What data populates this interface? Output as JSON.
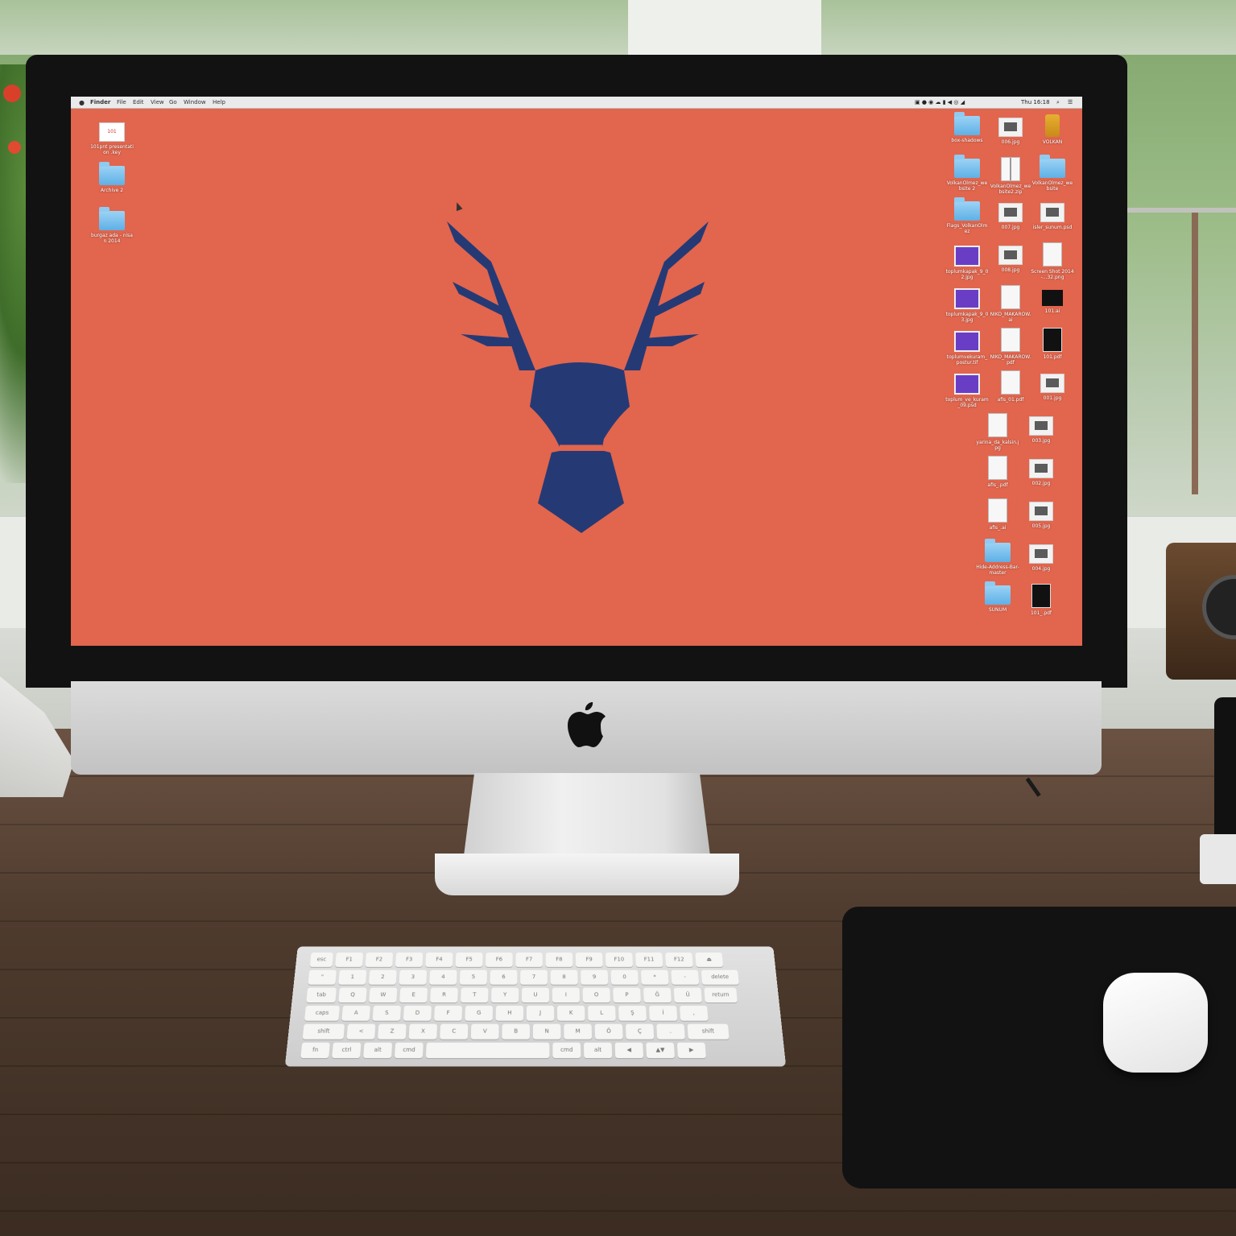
{
  "menubar": {
    "items": [
      "Finder",
      "File",
      "Edit",
      "View",
      "Go",
      "Window",
      "Help"
    ],
    "clock": "Thu 16:18"
  },
  "desktop": {
    "wallpaper_color": "#e2654d",
    "logo_color": "#253a75",
    "left_icons": [
      {
        "label": "101pnt presentation .key",
        "type": "keynote"
      },
      {
        "label": "Archive 2",
        "type": "folder"
      },
      {
        "label": "burgaz ada - nisan 2014",
        "type": "folder"
      }
    ],
    "right_icons": [
      {
        "label": "box-shadows",
        "type": "folder"
      },
      {
        "label": "006.jpg",
        "type": "thumb"
      },
      {
        "label": "VOLKAN",
        "type": "usb"
      },
      {
        "label": "VolkanOlmez_website 2",
        "type": "folder"
      },
      {
        "label": "VolkanOlmez_website2.zip",
        "type": "zip"
      },
      {
        "label": "VolkanOlmez_website",
        "type": "folder"
      },
      {
        "label": "Flags_VolkanOlmez",
        "type": "folder"
      },
      {
        "label": "007.jpg",
        "type": "thumb"
      },
      {
        "label": "isler_sunum.psd",
        "type": "thumb"
      },
      {
        "label": "toplumkapak_9_02.jpg",
        "type": "purple"
      },
      {
        "label": "008.jpg",
        "type": "thumb"
      },
      {
        "label": "Screen Shot 2014-...32.png",
        "type": "doc"
      },
      {
        "label": "toplumkapak_9_03.jpg",
        "type": "purple"
      },
      {
        "label": "NIKO_MAKAROW.ai",
        "type": "doc"
      },
      {
        "label": "101.ai",
        "type": "dark"
      },
      {
        "label": "toplumvekuram_postur.tif",
        "type": "purple"
      },
      {
        "label": "NIKO_MAKAROW.pdf",
        "type": "doc"
      },
      {
        "label": "101.pdf",
        "type": "pdf"
      },
      {
        "label": "toplum_ve_kuram_09.psd",
        "type": "purple"
      },
      {
        "label": "afis_01.pdf",
        "type": "doc"
      },
      {
        "label": "001.jpg",
        "type": "thumb"
      },
      {
        "label": "yarina_da_kalsin.jpg",
        "type": "doc"
      },
      {
        "label": "003.jpg",
        "type": "thumb"
      },
      {
        "label": "afis_.pdf",
        "type": "doc"
      },
      {
        "label": "002.jpg",
        "type": "thumb"
      },
      {
        "label": "afis_.ai",
        "type": "doc"
      },
      {
        "label": "005.jpg",
        "type": "thumb"
      },
      {
        "label": "Hide-Address-Bar-master",
        "type": "folder"
      },
      {
        "label": "004.jpg",
        "type": "thumb"
      },
      {
        "label": "SUNUM",
        "type": "folder"
      },
      {
        "label": "101_.pdf",
        "type": "pdf"
      }
    ]
  },
  "keyboard": {
    "rows": [
      [
        "esc",
        "F1",
        "F2",
        "F3",
        "F4",
        "F5",
        "F6",
        "F7",
        "F8",
        "F9",
        "F10",
        "F11",
        "F12",
        "⏏"
      ],
      [
        "\"",
        "1",
        "2",
        "3",
        "4",
        "5",
        "6",
        "7",
        "8",
        "9",
        "0",
        "*",
        "-",
        "delete"
      ],
      [
        "tab",
        "Q",
        "W",
        "E",
        "R",
        "T",
        "Y",
        "U",
        "I",
        "O",
        "P",
        "Ğ",
        "Ü",
        "return"
      ],
      [
        "caps",
        "A",
        "S",
        "D",
        "F",
        "G",
        "H",
        "J",
        "K",
        "L",
        "Ş",
        "İ",
        ","
      ],
      [
        "shift",
        "<",
        "Z",
        "X",
        "C",
        "V",
        "B",
        "N",
        "M",
        "Ö",
        "Ç",
        ".",
        "shift"
      ],
      [
        "fn",
        "ctrl",
        "alt",
        "cmd",
        "",
        "cmd",
        "alt",
        "◀",
        "▲▼",
        "▶"
      ]
    ]
  }
}
